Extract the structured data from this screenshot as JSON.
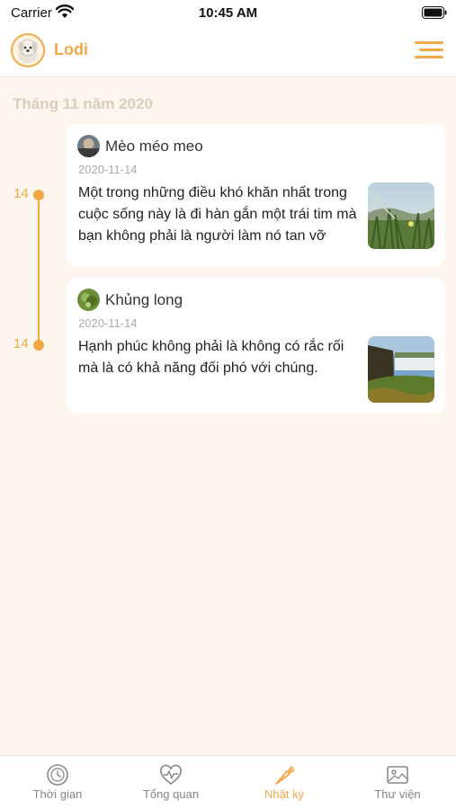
{
  "status_bar": {
    "carrier": "Carrier",
    "time": "10:45 AM"
  },
  "header": {
    "title": "Lodi"
  },
  "month_heading": "Tháng 11 năm 2020",
  "entries": [
    {
      "day": "14",
      "author": "Mèo méo meo",
      "date": "2020-11-14",
      "text": "Một trong những điều khó khăn nhất trong cuộc sống này là đi hàn gắn một trái tim mà bạn không phải là người làm nó tan vỡ"
    },
    {
      "day": "14",
      "author": "Khủng long",
      "date": "2020-11-14",
      "text": "Hạnh phúc không phải là không có rắc rối mà là có khả năng đối phó với chúng."
    }
  ],
  "tabs": [
    {
      "label": "Thời gian",
      "icon": "clock-icon"
    },
    {
      "label": "Tổng quan",
      "icon": "heartbeat-icon"
    },
    {
      "label": "Nhật ký",
      "icon": "carrot-icon"
    },
    {
      "label": "Thư viện",
      "icon": "gallery-icon"
    }
  ],
  "active_tab": "Nhật ký",
  "colors": {
    "accent": "#f3a847",
    "background": "#fdf6ee",
    "card": "#ffffff"
  }
}
